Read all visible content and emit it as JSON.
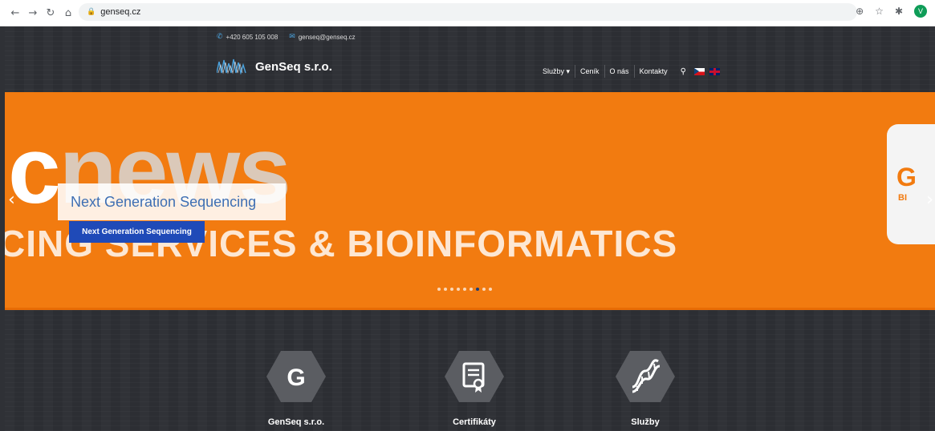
{
  "browser": {
    "back_icon": "arrow-left-icon",
    "forward_icon": "arrow-right-icon",
    "reload_icon": "reload-icon",
    "home_icon": "home-icon",
    "url": "genseq.cz",
    "profile_initial": "V"
  },
  "topbar": {
    "phone": "+420 605 105 008",
    "email": "genseq@genseq.cz"
  },
  "header": {
    "logo_text": "GenSeq s.r.o.",
    "menu": [
      {
        "label": "Služby ▾"
      },
      {
        "label": "Ceník"
      },
      {
        "label": "O nás"
      },
      {
        "label": "Kontakty"
      }
    ],
    "search_icon": "search-icon",
    "languages": [
      "cz-flag-icon",
      "uk-flag-icon"
    ]
  },
  "hero": {
    "bg_word_bold": "c",
    "bg_word": "news",
    "bg_line": "CING SERVICES & BIOINFORMATICS",
    "card_letter": "G",
    "card_sub": "BI",
    "caption_title": "Next Generation Sequencing",
    "caption_button": "Next Generation Sequencing",
    "prev": "‹",
    "next": "›",
    "dot_count": 9,
    "active_dot": 6
  },
  "features": [
    {
      "label": "GenSeq s.r.o.",
      "icon": "g-letter-icon"
    },
    {
      "label": "Certifikáty",
      "icon": "certificate-icon"
    },
    {
      "label": "Služby",
      "icon": "dna-icon"
    }
  ],
  "colors": {
    "hero_orange": "#f27b10",
    "caption_blue": "#3e6fb3",
    "button_blue": "#1f4ab8",
    "dark_bg": "#2c2e33"
  }
}
